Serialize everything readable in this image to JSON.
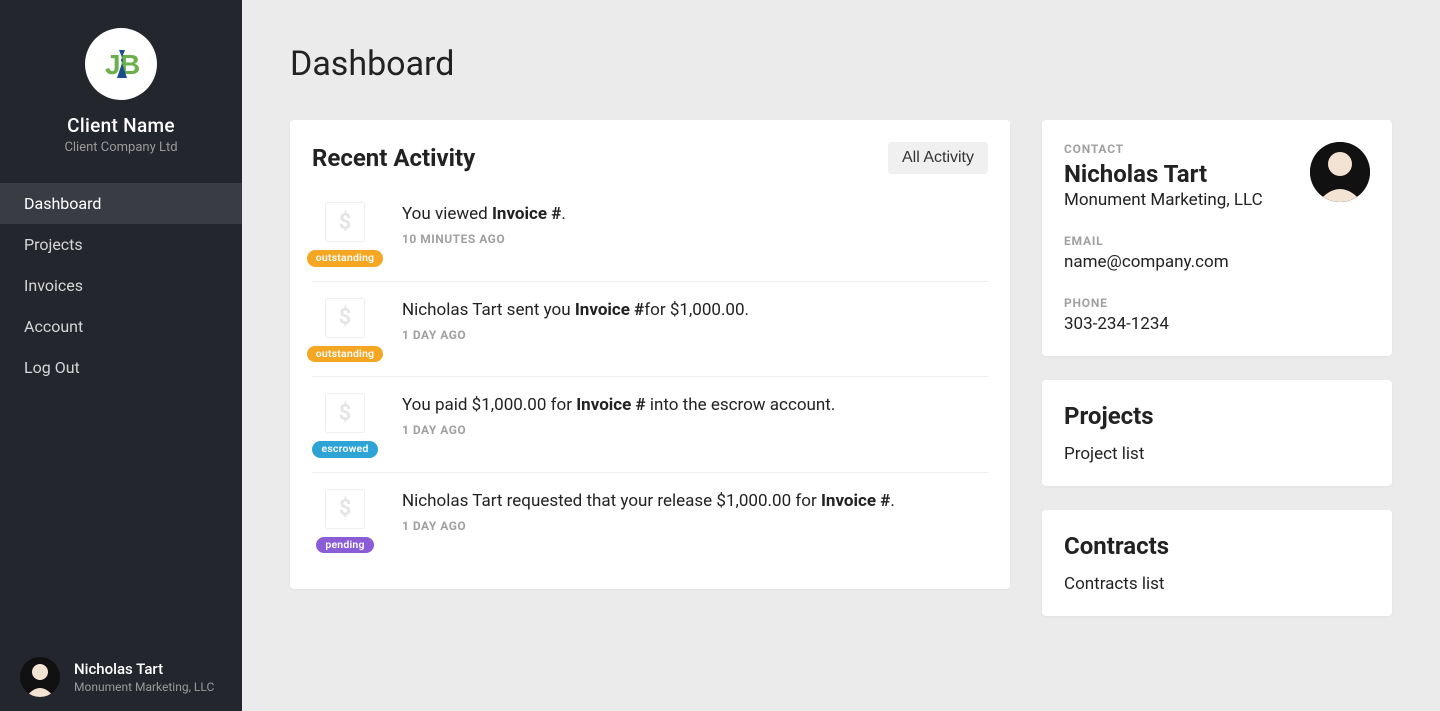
{
  "sidebar": {
    "client_name": "Client Name",
    "client_company": "Client Company Ltd",
    "logo_name": "jb-logo",
    "nav": [
      {
        "label": "Dashboard",
        "active": true
      },
      {
        "label": "Projects",
        "active": false
      },
      {
        "label": "Invoices",
        "active": false
      },
      {
        "label": "Account",
        "active": false
      },
      {
        "label": "Log Out",
        "active": false
      }
    ],
    "footer_name": "Nicholas Tart",
    "footer_company": "Monument Marketing, LLC"
  },
  "page": {
    "title": "Dashboard"
  },
  "activity": {
    "title": "Recent Activity",
    "all_button": "All Activity",
    "items": [
      {
        "icon": "dollar-icon",
        "badge_label": "outstanding",
        "badge_kind": "outstanding",
        "text_before": "You viewed ",
        "text_bold": "Invoice #",
        "text_after": ".",
        "time": "10 MINUTES AGO"
      },
      {
        "icon": "dollar-icon",
        "badge_label": "outstanding",
        "badge_kind": "outstanding",
        "text_before": "Nicholas Tart sent you ",
        "text_bold": "Invoice #",
        "text_after": "for $1,000.00.",
        "time": "1 DAY AGO"
      },
      {
        "icon": "dollar-icon",
        "badge_label": "escrowed",
        "badge_kind": "escrowed",
        "text_before": "You paid $1,000.00 for ",
        "text_bold": "Invoice #",
        "text_after": " into the escrow account.",
        "time": "1 DAY AGO"
      },
      {
        "icon": "dollar-icon",
        "badge_label": "pending",
        "badge_kind": "pending",
        "text_before": "Nicholas Tart requested that your release $1,000.00 for ",
        "text_bold": "Invoice #",
        "text_after": ".",
        "time": "1 DAY AGO"
      }
    ]
  },
  "contact": {
    "section_label": "CONTACT",
    "name": "Nicholas Tart",
    "company": "Monument Marketing, LLC",
    "email_label": "EMAIL",
    "email_value": "name@company.com",
    "phone_label": "PHONE",
    "phone_value": "303-234-1234"
  },
  "projects_card": {
    "title": "Projects",
    "text": "Project list"
  },
  "contracts_card": {
    "title": "Contracts",
    "text": "Contracts list"
  },
  "colors": {
    "sidebar_bg": "#24262d",
    "badge_outstanding": "#f5a623",
    "badge_escrowed": "#2ea3d6",
    "badge_pending": "#8a5cd6"
  }
}
